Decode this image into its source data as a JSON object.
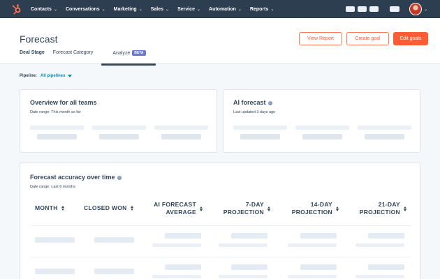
{
  "nav": {
    "items": [
      {
        "label": "Contacts"
      },
      {
        "label": "Conversations"
      },
      {
        "label": "Marketing"
      },
      {
        "label": "Sales"
      },
      {
        "label": "Service"
      },
      {
        "label": "Automation"
      },
      {
        "label": "Reports"
      }
    ],
    "chevron": "chevron-down-icon"
  },
  "header": {
    "title": "Forecast",
    "buttons": {
      "view_report": "View Report",
      "create_goal": "Create goal",
      "edit_goals": "Edit goals"
    },
    "tabs": [
      {
        "label": "Deal Stage"
      },
      {
        "label": "Forecast Category"
      },
      {
        "label": "Analyze",
        "badge": "BETA"
      }
    ]
  },
  "filter": {
    "label": "Pipeline:",
    "value": "All pipelines"
  },
  "overview": {
    "title": "Overview for all teams",
    "subtitle": "Date range: This month so far"
  },
  "ai_forecast": {
    "title": "AI forecast",
    "subtitle": "Last updated 3 days ago"
  },
  "accuracy": {
    "title": "Forecast accuracy over time",
    "subtitle": "Date range: Last 6 months",
    "columns": [
      {
        "line1": "MONTH"
      },
      {
        "line1": "CLOSED WON"
      },
      {
        "line1": "AI FORECAST",
        "line2": "AVERAGE"
      },
      {
        "line1": "7-DAY",
        "line2": "PROJECTION"
      },
      {
        "line1": "14-DAY",
        "line2": "PROJECTION"
      },
      {
        "line1": "21-DAY",
        "line2": "PROJECTION"
      }
    ]
  },
  "colors": {
    "nav_bg": "#2d3e50",
    "accent": "#ff5c35",
    "link": "#0091ae",
    "beta": "#6a78d1",
    "text": "#33475b",
    "skeleton": "#eaf0f6"
  }
}
